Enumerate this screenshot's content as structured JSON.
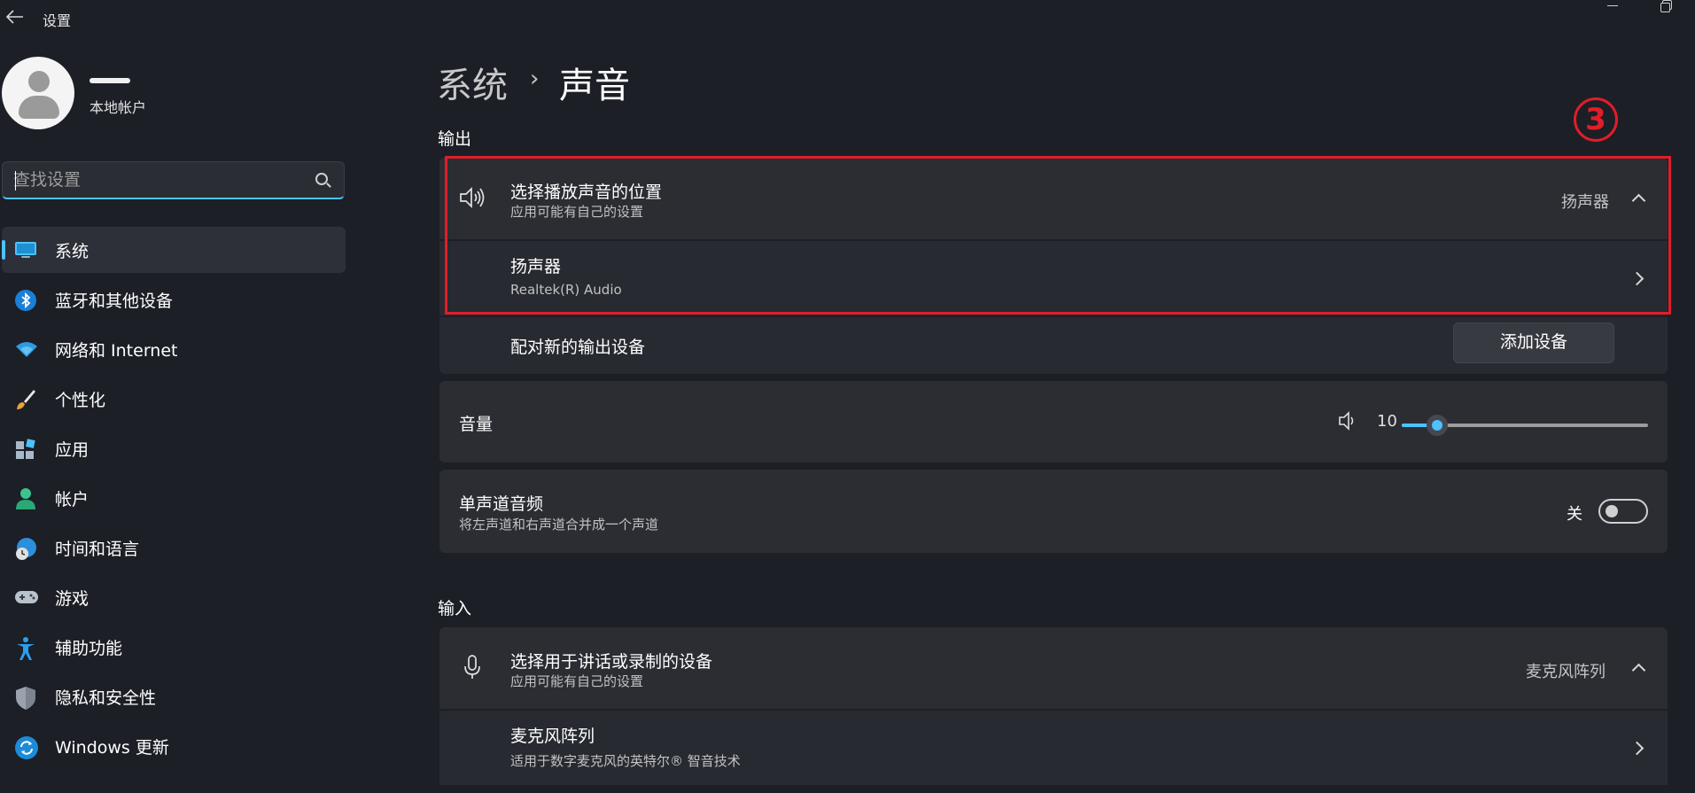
{
  "window": {
    "title": "设置"
  },
  "profile": {
    "account_type": "本地帐户"
  },
  "search": {
    "placeholder": "查找设置"
  },
  "sidebar": {
    "items": [
      {
        "label": "系统",
        "icon": "monitor-icon",
        "active": true
      },
      {
        "label": "蓝牙和其他设备",
        "icon": "bluetooth-icon"
      },
      {
        "label": "网络和 Internet",
        "icon": "wifi-icon"
      },
      {
        "label": "个性化",
        "icon": "paintbrush-icon"
      },
      {
        "label": "应用",
        "icon": "apps-icon"
      },
      {
        "label": "帐户",
        "icon": "person-icon"
      },
      {
        "label": "时间和语言",
        "icon": "globe-clock-icon"
      },
      {
        "label": "游戏",
        "icon": "gamepad-icon"
      },
      {
        "label": "辅助功能",
        "icon": "accessibility-icon"
      },
      {
        "label": "隐私和安全性",
        "icon": "shield-icon"
      },
      {
        "label": "Windows 更新",
        "icon": "update-icon"
      }
    ]
  },
  "breadcrumb": {
    "parent": "系统",
    "separator": "›",
    "current": "声音"
  },
  "annotation": {
    "step": "3",
    "color": "#e11d2a"
  },
  "output": {
    "section_label": "输出",
    "choose_device": {
      "title": "选择播放声音的位置",
      "subtitle": "应用可能有自己的设置",
      "value": "扬声器"
    },
    "device": {
      "title": "扬声器",
      "subtitle": "Realtek(R) Audio"
    },
    "pair": {
      "title": "配对新的输出设备",
      "button": "添加设备"
    },
    "volume": {
      "label": "音量",
      "value": "10",
      "level": 10
    },
    "mono": {
      "title": "单声道音频",
      "subtitle": "将左声道和右声道合并成一个声道",
      "state": "关",
      "on": false
    }
  },
  "input": {
    "section_label": "输入",
    "choose_device": {
      "title": "选择用于讲话或录制的设备",
      "subtitle": "应用可能有自己的设置",
      "value": "麦克风阵列"
    },
    "device": {
      "title": "麦克风阵列",
      "subtitle": "适用于数字麦克风的英特尔® 智音技术"
    }
  },
  "colors": {
    "accent": "#4cc2ff",
    "background": "#1c1f26",
    "card": "#2b2d33"
  }
}
